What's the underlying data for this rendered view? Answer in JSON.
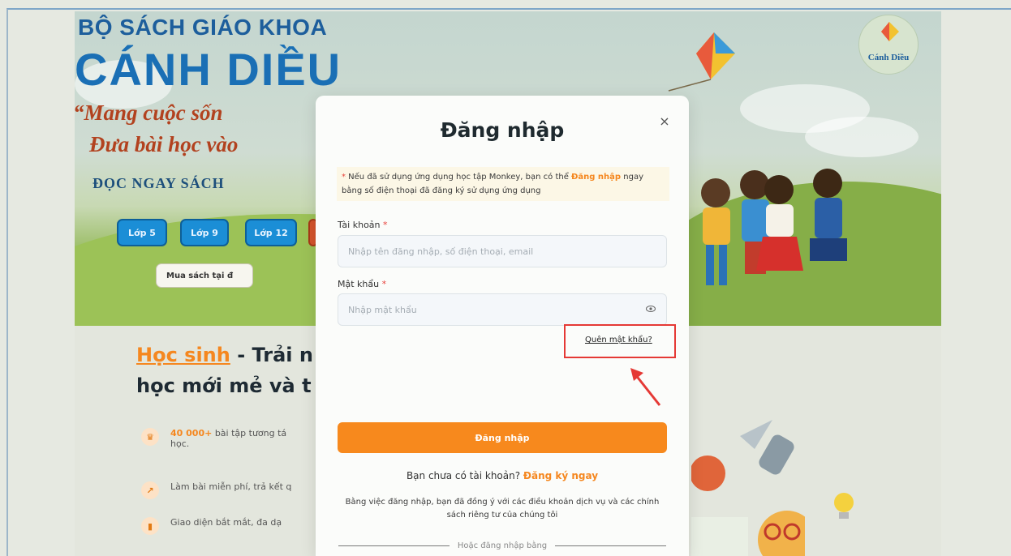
{
  "hero": {
    "title_line1": "BỘ SÁCH GIÁO KHOA",
    "title_line2": "CÁNH DIỀU",
    "quote_line1": "“Mang cuộc sốn",
    "quote_line2": "Đưa bài học vào",
    "read_now": "ĐỌC NGAY SÁCH",
    "grade_buttons": [
      "Lớp 5",
      "Lớp 9",
      "Lớp 12"
    ],
    "buy_button": "Mua sách tại đ",
    "logo_text": "Cánh Diều"
  },
  "section": {
    "heading_accent": "Học sinh",
    "heading_rest": " - Trải n",
    "heading_line2": "học mới mẻ và t",
    "features": [
      {
        "icon": "trophy-icon",
        "highlight": "40 000+",
        "text": " bài tập tương tá",
        "text2": "học."
      },
      {
        "icon": "chart-icon",
        "highlight": "",
        "text": "Làm bài miễn phí, trả kết q",
        "text2": ""
      },
      {
        "icon": "bar-icon",
        "highlight": "",
        "text": "Giao diện bắt mắt, đa dạ",
        "text2": ""
      }
    ]
  },
  "modal": {
    "title": "Đăng nhập",
    "close_glyph": "×",
    "notice_star": "*",
    "notice_text1": " Nếu đã sử dụng ứng dụng học tập Monkey, bạn có thể ",
    "notice_link": "Đăng nhập",
    "notice_text2": " ngay bằng số điện thoại đã đăng ký sử dụng ứng dụng",
    "account_label": "Tài khoản",
    "account_placeholder": "Nhập tên đăng nhập, số điện thoại, email",
    "password_label": "Mật khẩu",
    "password_placeholder": "Nhập mật khẩu",
    "required_mark": "*",
    "forgot_password": "Quên mật khẩu?",
    "login_button": "Đăng nhập",
    "no_account": "Bạn chưa có tài khoản? ",
    "signup_link": "Đăng ký ngay",
    "terms": "Bằng việc đăng nhập, bạn đã đồng ý với các điều khoản dịch vụ và các chính sách riêng tư của chúng tôi",
    "or_login_with": "Hoặc đăng nhập bằng"
  },
  "colors": {
    "accent": "#f7891d",
    "annotation": "#e53935",
    "brand_blue": "#1a6fb5"
  }
}
